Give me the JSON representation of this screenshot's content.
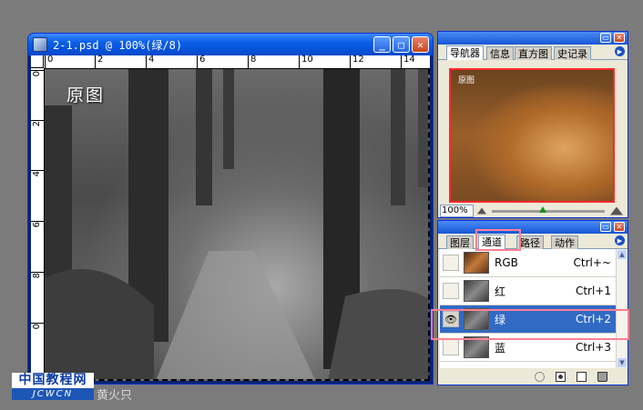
{
  "document": {
    "title": "2-1.psd @ 100%(绿/8)",
    "canvas_label": "原图",
    "ruler_h": [
      "0",
      "2",
      "4",
      "6",
      "8",
      "10",
      "12",
      "14"
    ],
    "ruler_v": [
      "0",
      "2",
      "4",
      "6",
      "8",
      "0"
    ]
  },
  "navigator": {
    "tabs": [
      "导航器",
      "信息",
      "直方图",
      "史记录"
    ],
    "preview_label": "原图",
    "zoom": "100%"
  },
  "channels": {
    "tabs": [
      "图层",
      "通道",
      "路径",
      "动作"
    ],
    "active_tab_index": 1,
    "rows": [
      {
        "name": "RGB",
        "shortcut": "Ctrl+~",
        "visible": false
      },
      {
        "name": "红",
        "shortcut": "Ctrl+1",
        "visible": false
      },
      {
        "name": "绿",
        "shortcut": "Ctrl+2",
        "visible": true,
        "selected": true
      },
      {
        "name": "蓝",
        "shortcut": "Ctrl+3",
        "visible": false
      }
    ]
  },
  "watermark": {
    "site_cn": "中国教程网",
    "site_en": "JCWCN",
    "signature": "黄火只"
  },
  "colors": {
    "selection": "#316ac5",
    "highlight": "#ff7f94",
    "title_blue": "#0a5fe6"
  }
}
